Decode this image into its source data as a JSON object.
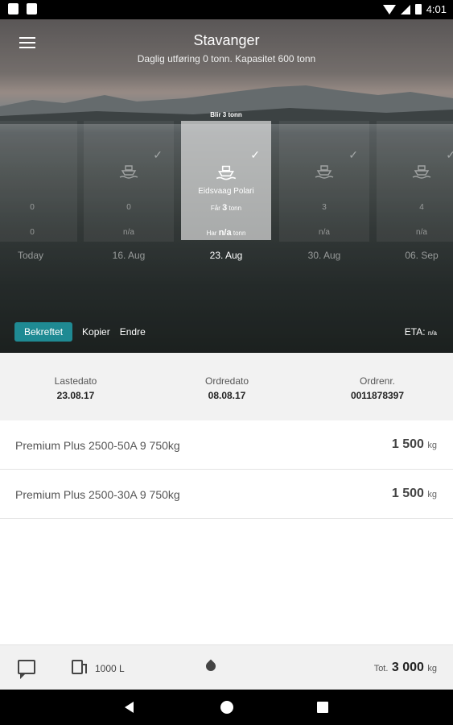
{
  "status_bar": {
    "time": "4:01"
  },
  "header": {
    "title": "Stavanger",
    "subtitle": "Daglig utføring 0 tonn. Kapasitet 600 tonn"
  },
  "days": [
    {
      "num1": "0",
      "num2": "0"
    },
    {
      "num1": "0",
      "num2": "n/a"
    },
    {
      "blir": "Blir 3 tonn",
      "name": "Eidsvaag Polari",
      "faar_prefix": "Får",
      "faar_value": "3",
      "faar_unit": "tonn",
      "har_prefix": "Har",
      "har_value": "n/a",
      "har_unit": "tonn"
    },
    {
      "num1": "3",
      "num2": "n/a"
    },
    {
      "num1": "4",
      "num2": "n/a"
    }
  ],
  "dates": [
    "Today",
    "16. Aug",
    "23. Aug",
    "30. Aug",
    "06. Sep"
  ],
  "actions": {
    "confirmed": "Bekreftet",
    "copy": "Kopier",
    "edit": "Endre",
    "eta_label": "ETA:",
    "eta_value": "n/a"
  },
  "info": {
    "loading_date_label": "Lastedato",
    "loading_date": "23.08.17",
    "order_date_label": "Ordredato",
    "order_date": "08.08.17",
    "order_no_label": "Ordrenr.",
    "order_no": "0011878397"
  },
  "items": [
    {
      "name": "Premium Plus 2500-50A 9 750kg",
      "qty": "1 500",
      "unit": "kg"
    },
    {
      "name": "Premium Plus 2500-30A 9 750kg",
      "qty": "1 500",
      "unit": "kg"
    }
  ],
  "footer": {
    "fuel": "1000 L",
    "total_label": "Tot.",
    "total_value": "3 000",
    "total_unit": "kg"
  }
}
